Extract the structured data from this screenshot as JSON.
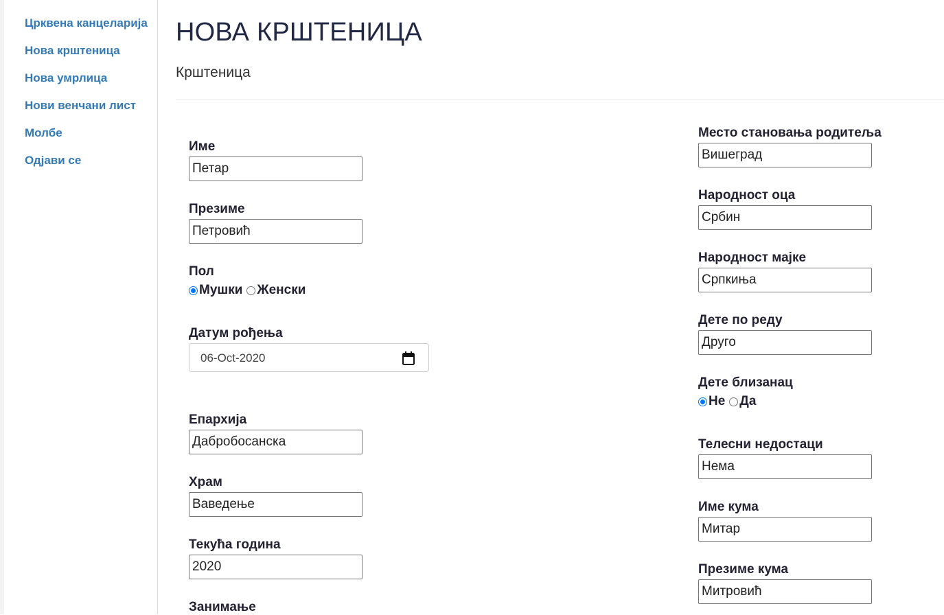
{
  "sidebar": {
    "items": [
      {
        "label": "Црквена канцеларија"
      },
      {
        "label": "Нова крштеница"
      },
      {
        "label": "Нова умрлица"
      },
      {
        "label": "Нови венчани лист"
      },
      {
        "label": "Молбе"
      },
      {
        "label": "Одјави се"
      }
    ]
  },
  "page": {
    "title": "НОВА КРШТЕНИЦА",
    "subtitle": "Крштеница"
  },
  "form_left": {
    "first_name": {
      "label": "Име",
      "value": "Петар"
    },
    "last_name": {
      "label": "Презиме",
      "value": "Петровић"
    },
    "gender": {
      "label": "Пол",
      "options": [
        "Мушки",
        "Женски"
      ],
      "selected": "Мушки"
    },
    "birth_date": {
      "label": "Датум рођења",
      "value": "06-Oct-2020"
    },
    "eparchy": {
      "label": "Епархија",
      "value": "Дабробосанска"
    },
    "temple": {
      "label": "Храм",
      "value": "Ваведење"
    },
    "current_year": {
      "label": "Текућа година",
      "value": "2020"
    },
    "occupation": {
      "label": "Занимање"
    }
  },
  "form_right": {
    "parents_residence": {
      "label": "Место становања родитеља",
      "value": "Вишеград"
    },
    "father_nationality": {
      "label": "Народност оца",
      "value": "Србин"
    },
    "mother_nationality": {
      "label": "Народност мајке",
      "value": "Српкиња"
    },
    "child_order": {
      "label": "Дете по реду",
      "value": "Друго"
    },
    "twin": {
      "label": "Дете близанац",
      "options": [
        "Не",
        "Да"
      ],
      "selected": "Не"
    },
    "physical_defects": {
      "label": "Телесни недостаци",
      "value": "Нема"
    },
    "godparent_name": {
      "label": "Име кума",
      "value": "Митар"
    },
    "godparent_surname": {
      "label": "Презиме кума",
      "value": "Митровић"
    }
  },
  "colors": {
    "link": "#337ab7",
    "radio_checked": "#0075ff",
    "title": "#202844"
  }
}
